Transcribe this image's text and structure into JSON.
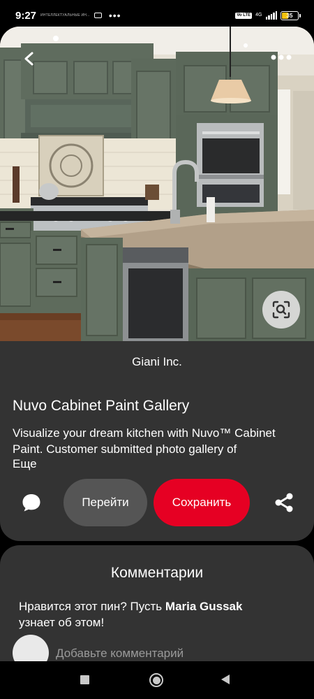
{
  "status_bar": {
    "time": "9:27",
    "mini_text": "ИНТЕЛЛЕКТУАЛЬНЫЕ ИН...",
    "volte": "Vo LTE",
    "network": "4G",
    "battery": "35",
    "battery_color": "#f4c20d"
  },
  "pin": {
    "source": "Giani Inc.",
    "title": "Nuvo Cabinet Paint Gallery",
    "description": "Visualize your dream kitchen with Nuvo™ Cabinet Paint. Customer submitted photo gallery of",
    "more_label": "Еще",
    "visit_label": "Перейти",
    "save_label": "Сохранить",
    "icons": {
      "back": "back-arrow-icon",
      "more": "more-options-icon",
      "lens": "visual-search-icon",
      "comment": "comment-bubble-icon",
      "share": "share-icon"
    },
    "colors": {
      "card": "#333333",
      "save": "#e60023",
      "visit": "#555555"
    }
  },
  "comments": {
    "title": "Комментарии",
    "prompt_prefix": "Нравится этот пин? Пусть",
    "prompt_name": "Maria Gussak",
    "prompt_suffix": "узнает об этом!",
    "placeholder": "Добавьте комментарий"
  },
  "nav_bar": {
    "recent": "recent-apps-icon",
    "home": "home-icon",
    "back": "back-triangle-icon"
  }
}
